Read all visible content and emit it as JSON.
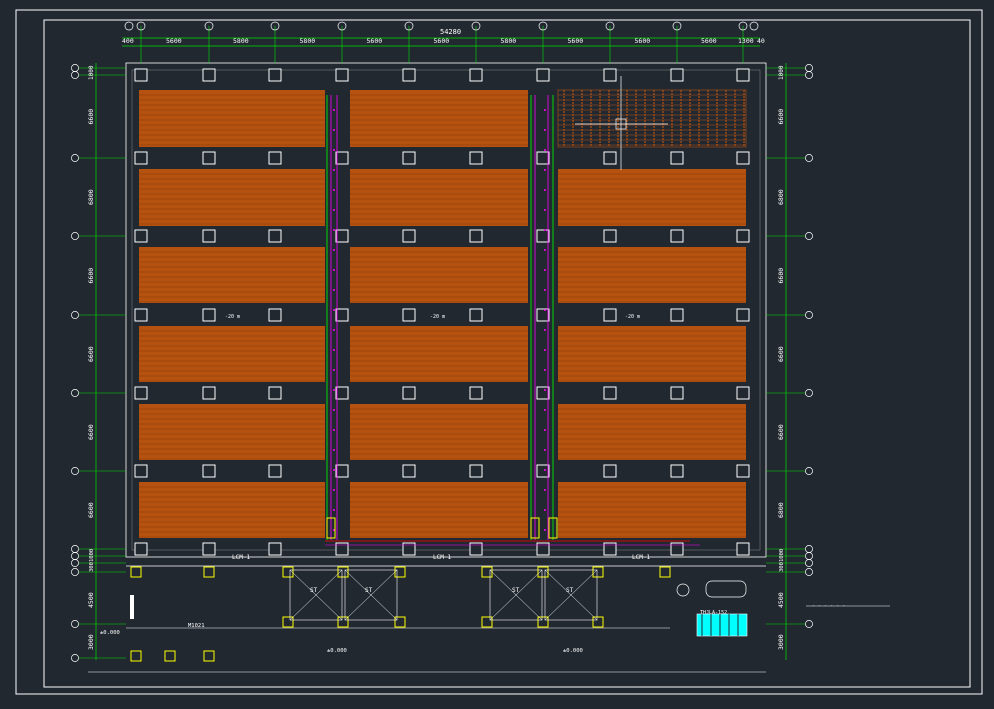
{
  "drawing": {
    "colors": {
      "background": "#212830",
      "frame": "#ffffff",
      "dimension": "#00e000",
      "column": "#ffffff",
      "tray": "#b5520f",
      "tray_line": "#8a3a08",
      "pipe_magenta": "#ff00ff",
      "pipe_green": "#00ff00",
      "yellow": "#ffff00",
      "cyan": "#00ffff",
      "red": "#ff0000"
    },
    "overall_dimension": "54280",
    "top_dimensions": [
      "5600",
      "5800",
      "5800",
      "5600",
      "5600",
      "5800",
      "5600",
      "5600",
      "5600",
      "5600"
    ],
    "top_end_left": "400",
    "top_end_right": "1300",
    "top_end_right2": "40",
    "left_dimensions": [
      "6600",
      "6800",
      "6600",
      "6600",
      "6600",
      "6600"
    ],
    "right_dimensions": [
      "6600",
      "6800",
      "6600",
      "6600",
      "6600",
      "6800"
    ],
    "left_top_small": "1000",
    "lower_dims": [
      "4500",
      "3000"
    ],
    "lower_small": [
      "1000",
      "300"
    ],
    "room_labels": [
      "-20 m",
      "-20 m",
      "-20 m"
    ],
    "corridor_labels": [
      "LCM-1",
      "LCM-1",
      "LCM-1"
    ],
    "elev_labels": [
      "±0.000",
      "±0.000",
      "±0.000"
    ],
    "stair_labels": [
      "ST",
      "ST",
      "ST",
      "ST"
    ],
    "door_label": "M1021",
    "side_note": "- - - - - -",
    "equip_label": "THJLA-152"
  }
}
